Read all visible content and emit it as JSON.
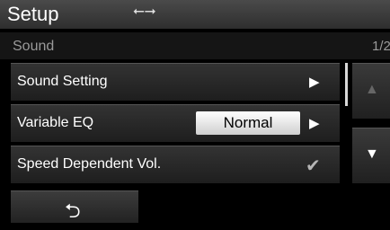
{
  "header": {
    "title": "Setup",
    "usb_icon": "usb-icon"
  },
  "subheader": {
    "section": "Sound",
    "page": "1/2"
  },
  "list": {
    "items": [
      {
        "label": "Sound Setting",
        "arrow": "▶"
      },
      {
        "label": "Variable EQ",
        "value": "Normal",
        "arrow": "▶"
      },
      {
        "label": "Speed Dependent Vol.",
        "checked": true,
        "check": "✔"
      }
    ]
  },
  "scroll": {
    "up": "▲",
    "down": "▼"
  },
  "footer": {
    "back": "⮌"
  },
  "colors": {
    "value_box": "#ffffff",
    "background": "#000000"
  }
}
